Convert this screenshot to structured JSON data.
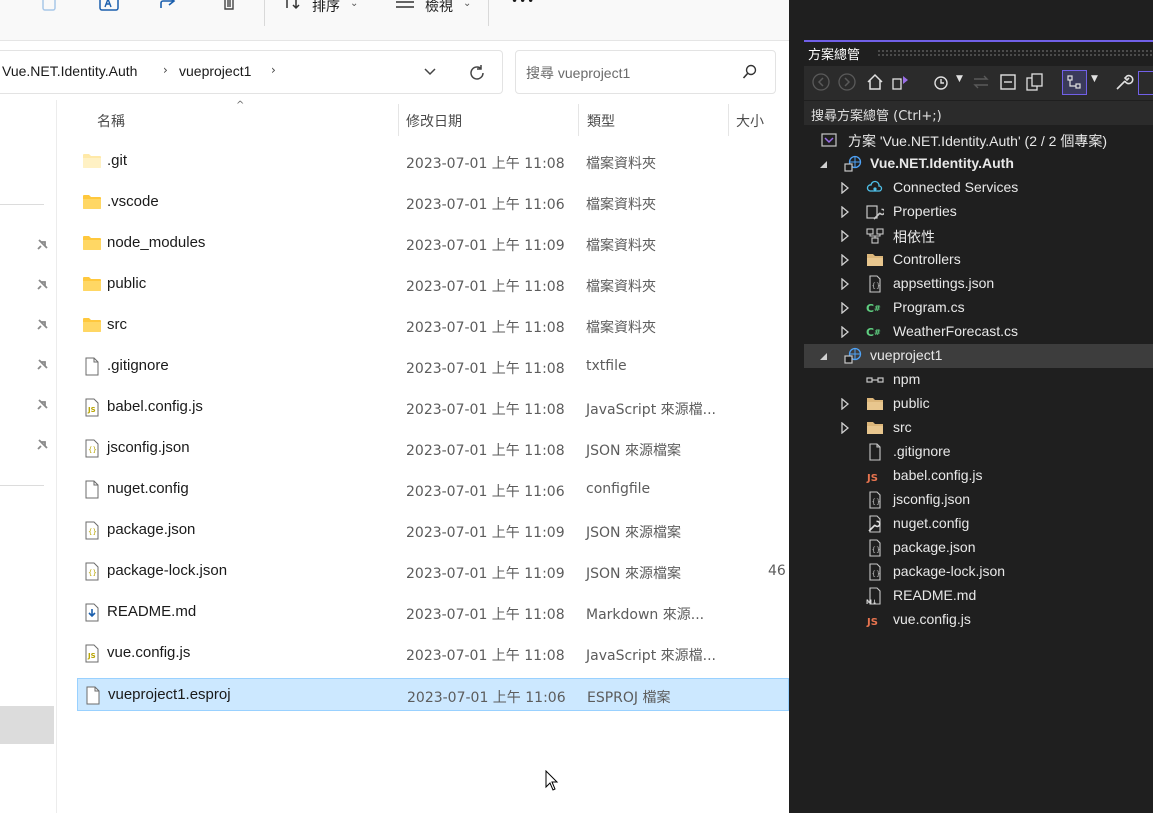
{
  "toolbar": {
    "sort_label": "排序",
    "view_label": "檢視",
    "more_label": "•••"
  },
  "address": {
    "crumbs": [
      "Vue.NET.Identity.Auth",
      "vueproject1"
    ]
  },
  "search": {
    "placeholder": "搜尋 vueproject1"
  },
  "columns": {
    "name": "名稱",
    "date": "修改日期",
    "type": "類型",
    "size": "大小"
  },
  "files": [
    {
      "name": ".git",
      "date": "2023-07-01 上午 11:08",
      "type": "檔案資料夾",
      "size": "",
      "icon": "folder-light-icon"
    },
    {
      "name": ".vscode",
      "date": "2023-07-01 上午 11:06",
      "type": "檔案資料夾",
      "size": "",
      "icon": "folder-icon"
    },
    {
      "name": "node_modules",
      "date": "2023-07-01 上午 11:09",
      "type": "檔案資料夾",
      "size": "",
      "icon": "folder-icon"
    },
    {
      "name": "public",
      "date": "2023-07-01 上午 11:08",
      "type": "檔案資料夾",
      "size": "",
      "icon": "folder-icon"
    },
    {
      "name": "src",
      "date": "2023-07-01 上午 11:08",
      "type": "檔案資料夾",
      "size": "",
      "icon": "folder-icon"
    },
    {
      "name": ".gitignore",
      "date": "2023-07-01 上午 11:08",
      "type": "txtfile",
      "size": "",
      "icon": "file-icon"
    },
    {
      "name": "babel.config.js",
      "date": "2023-07-01 上午 11:08",
      "type": "JavaScript 來源檔...",
      "size": "",
      "icon": "js-file-icon"
    },
    {
      "name": "jsconfig.json",
      "date": "2023-07-01 上午 11:08",
      "type": "JSON 來源檔案",
      "size": "",
      "icon": "json-file-icon"
    },
    {
      "name": "nuget.config",
      "date": "2023-07-01 上午 11:06",
      "type": "configfile",
      "size": "",
      "icon": "file-icon"
    },
    {
      "name": "package.json",
      "date": "2023-07-01 上午 11:09",
      "type": "JSON 來源檔案",
      "size": "",
      "icon": "json-file-icon"
    },
    {
      "name": "package-lock.json",
      "date": "2023-07-01 上午 11:09",
      "type": "JSON 來源檔案",
      "size": "46",
      "icon": "json-file-icon"
    },
    {
      "name": "README.md",
      "date": "2023-07-01 上午 11:08",
      "type": "Markdown 來源...",
      "size": "",
      "icon": "markdown-file-icon"
    },
    {
      "name": "vue.config.js",
      "date": "2023-07-01 上午 11:08",
      "type": "JavaScript 來源檔...",
      "size": "",
      "icon": "js-file-icon"
    },
    {
      "name": "vueproject1.esproj",
      "date": "2023-07-01 上午 11:06",
      "type": "ESPROJ 檔案",
      "size": "",
      "icon": "file-icon",
      "selected": true
    }
  ],
  "solution_explorer": {
    "title": "方案總管",
    "search_placeholder": "搜尋方案總管 (Ctrl+;)",
    "tree": [
      {
        "label": "方案 'Vue.NET.Identity.Auth' (2 / 2 個專案)",
        "level": 0,
        "arrow": "none",
        "icon": "solution-icon",
        "bold": false
      },
      {
        "label": "Vue.NET.Identity.Auth",
        "level": 1,
        "arrow": "expanded",
        "icon": "web-project-icon",
        "bold": true
      },
      {
        "label": "Connected Services",
        "level": 2,
        "arrow": "collapsed",
        "icon": "connected-services-icon",
        "bold": false
      },
      {
        "label": "Properties",
        "level": 2,
        "arrow": "collapsed",
        "icon": "properties-icon",
        "bold": false
      },
      {
        "label": "相依性",
        "level": 2,
        "arrow": "collapsed",
        "icon": "dependencies-icon",
        "bold": false
      },
      {
        "label": "Controllers",
        "level": 2,
        "arrow": "collapsed",
        "icon": "folder-icon",
        "bold": false
      },
      {
        "label": "appsettings.json",
        "level": 2,
        "arrow": "collapsed",
        "icon": "json-file-icon",
        "bold": false
      },
      {
        "label": "Program.cs",
        "level": 2,
        "arrow": "collapsed",
        "icon": "csharp-file-icon",
        "bold": false
      },
      {
        "label": "WeatherForecast.cs",
        "level": 2,
        "arrow": "collapsed",
        "icon": "csharp-file-icon",
        "bold": false
      },
      {
        "label": "vueproject1",
        "level": 1,
        "arrow": "expanded",
        "icon": "vue-project-icon",
        "bold": false,
        "selected": true
      },
      {
        "label": "npm",
        "level": 2,
        "arrow": "none",
        "icon": "npm-icon",
        "bold": false
      },
      {
        "label": "public",
        "level": 2,
        "arrow": "collapsed",
        "icon": "folder-icon",
        "bold": false
      },
      {
        "label": "src",
        "level": 2,
        "arrow": "collapsed",
        "icon": "folder-icon",
        "bold": false
      },
      {
        "label": ".gitignore",
        "level": 2,
        "arrow": "none",
        "icon": "file-icon",
        "bold": false
      },
      {
        "label": "babel.config.js",
        "level": 2,
        "arrow": "none",
        "icon": "js-file-icon",
        "bold": false
      },
      {
        "label": "jsconfig.json",
        "level": 2,
        "arrow": "none",
        "icon": "json-file-icon",
        "bold": false
      },
      {
        "label": "nuget.config",
        "level": 2,
        "arrow": "none",
        "icon": "config-file-icon",
        "bold": false
      },
      {
        "label": "package.json",
        "level": 2,
        "arrow": "none",
        "icon": "json-file-icon",
        "bold": false
      },
      {
        "label": "package-lock.json",
        "level": 2,
        "arrow": "none",
        "icon": "json-file-icon",
        "bold": false
      },
      {
        "label": "README.md",
        "level": 2,
        "arrow": "none",
        "icon": "markdown-file-icon",
        "bold": false
      },
      {
        "label": "vue.config.js",
        "level": 2,
        "arrow": "none",
        "icon": "js-file-icon",
        "bold": false
      }
    ]
  },
  "colors": {
    "selection": "#cce8ff",
    "folder": "#ffc83d",
    "vs_background": "#1f1f1f",
    "vs_accent": "#7160e8"
  }
}
